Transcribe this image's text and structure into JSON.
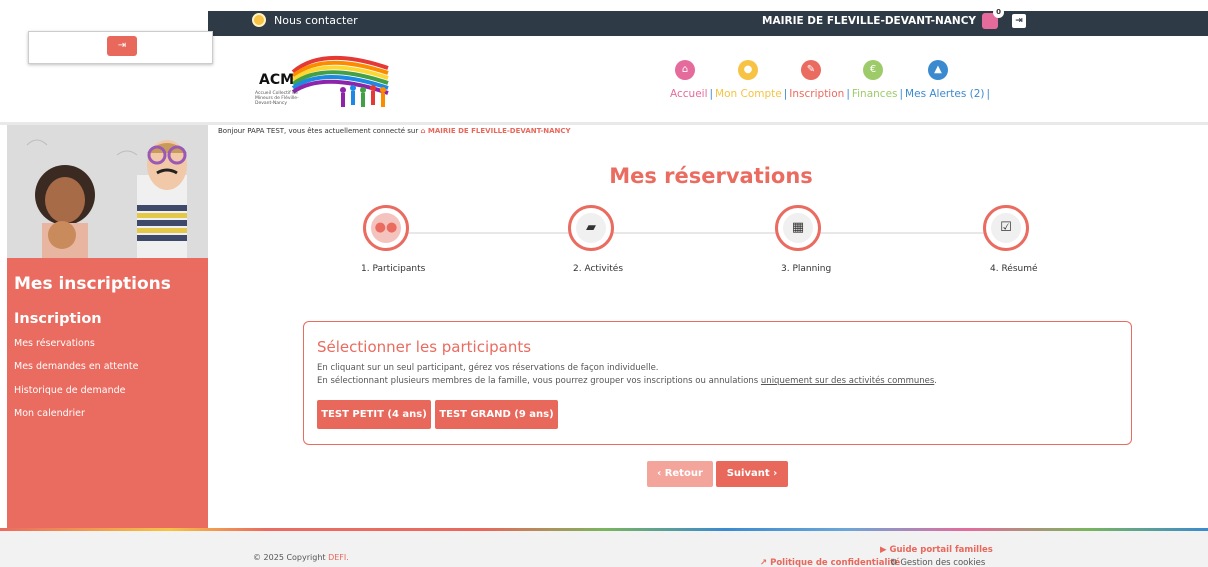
{
  "topbar": {
    "contact_label": "Nous contacter",
    "mairie_label": "MAIRIE DE FLEVILLE-DEVANT-NANCY",
    "notification_count": "0"
  },
  "nav": {
    "items": [
      {
        "label": "Accueil",
        "color": "#e46b9c",
        "icon": "home-icon"
      },
      {
        "label": "Mon Compte",
        "color": "#f6c344",
        "icon": "user-icon"
      },
      {
        "label": "Inscription",
        "color": "#ea6b5f",
        "icon": "pencil-icon"
      },
      {
        "label": "Finances",
        "color": "#9ecb6a",
        "icon": "euro-icon"
      },
      {
        "label": "Mes Alertes (2)",
        "color": "#3b8ad0",
        "icon": "warning-icon"
      }
    ]
  },
  "logo": {
    "text": "ACM",
    "subtitle": "Accueil Collectif de Mineurs de Fléville-Devant-Nancy"
  },
  "sidebar": {
    "title": "Mes inscriptions",
    "subtitle": "Inscription",
    "links": [
      "Mes réservations",
      "Mes demandes en attente",
      "Historique de demande",
      "Mon calendrier"
    ]
  },
  "main": {
    "greeting_prefix": "Bonjour PAPA TEST, vous êtes actuellement connecté sur",
    "greeting_mairie": "MAIRIE DE FLEVILLE-DEVANT-NANCY",
    "title": "Mes réservations",
    "steps": [
      "1. Participants",
      "2. Activités",
      "3. Planning",
      "4. Résumé"
    ],
    "panel": {
      "title": "Sélectionner les participants",
      "line1": "En cliquant sur un seul participant, gérez vos réservations de façon individuelle.",
      "line2_prefix": "En sélectionnant plusieurs membres de la famille, vous pourrez grouper vos inscriptions ou annulations",
      "line2_underlined": "uniquement sur des activités communes",
      "participants": [
        "TEST PETIT (4 ans)",
        "TEST GRAND (9 ans)"
      ]
    },
    "back_label": "Retour",
    "next_label": "Suivant"
  },
  "footer": {
    "copyright_prefix": "© 2025 Copyright",
    "copyright_brand": "DEFI.",
    "guide_label": "Guide portail familles",
    "privacy_label": "Politique de confidentialité",
    "cookies_label": "Gestion des cookies"
  },
  "colors": {
    "accent": "#ea6b5f",
    "topbar": "#2f3a47"
  }
}
